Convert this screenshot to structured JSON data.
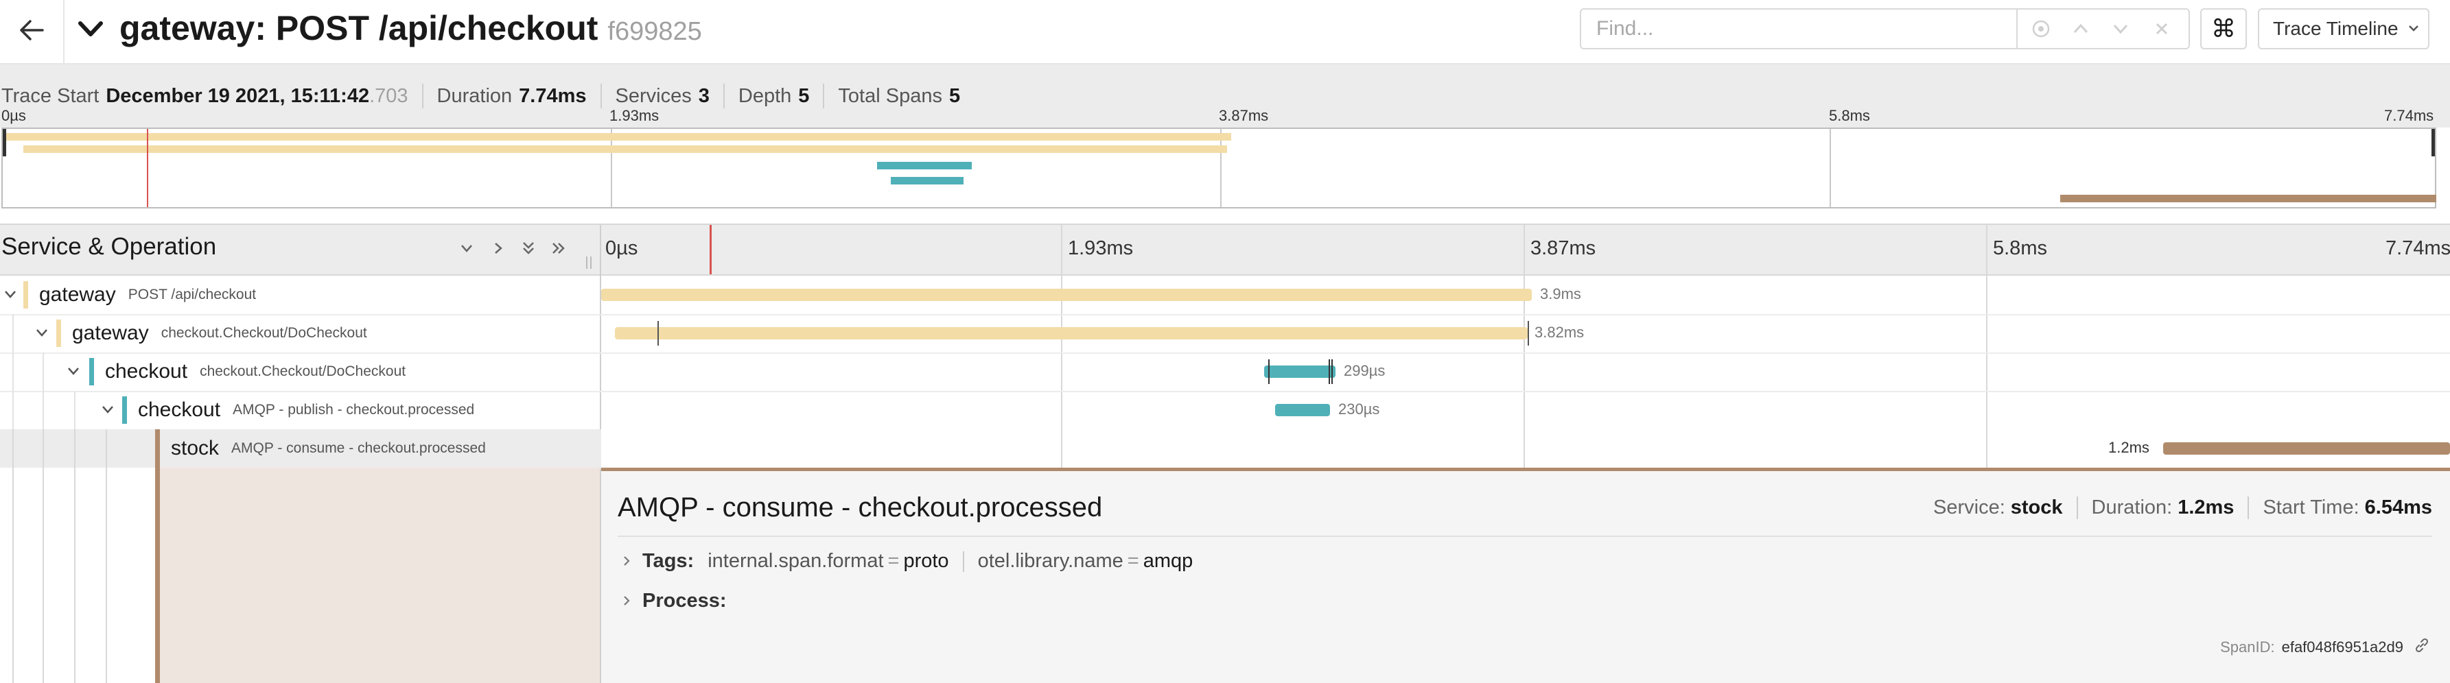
{
  "header": {
    "title": "gateway: POST /api/checkout",
    "trace_id": "f699825",
    "find_placeholder": "Find...",
    "view_select": "Trace Timeline"
  },
  "summary": {
    "trace_start_label": "Trace Start",
    "trace_start_value": "December 19 2021, 15:11:42",
    "trace_start_ms": ".703",
    "duration_label": "Duration",
    "duration_value": "7.74ms",
    "services_label": "Services",
    "services_value": "3",
    "depth_label": "Depth",
    "depth_value": "5",
    "total_spans_label": "Total Spans",
    "total_spans_value": "5"
  },
  "minimap": {
    "ticks": [
      "0µs",
      "1.93ms",
      "3.87ms",
      "5.8ms",
      "7.74ms"
    ]
  },
  "timeline": {
    "column_label": "Service & Operation",
    "ticks": [
      "0µs",
      "1.93ms",
      "3.87ms",
      "5.8ms",
      "7.74ms"
    ]
  },
  "spans": [
    {
      "service": "gateway",
      "operation": "POST /api/checkout",
      "duration": "3.9ms",
      "color": "#f3dca6"
    },
    {
      "service": "gateway",
      "operation": "checkout.Checkout/DoCheckout",
      "duration": "3.82ms",
      "color": "#f3dca6"
    },
    {
      "service": "checkout",
      "operation": "checkout.Checkout/DoCheckout",
      "duration": "299µs",
      "color": "#4fb0b8"
    },
    {
      "service": "checkout",
      "operation": "AMQP - publish - checkout.processed",
      "duration": "230µs",
      "color": "#4fb0b8"
    },
    {
      "service": "stock",
      "operation": "AMQP - consume - checkout.processed",
      "duration": "1.2ms",
      "color": "#b08b6b"
    }
  ],
  "detail": {
    "title": "AMQP - consume - checkout.processed",
    "service_label": "Service:",
    "service_value": "stock",
    "duration_label": "Duration:",
    "duration_value": "1.2ms",
    "start_label": "Start Time:",
    "start_value": "6.54ms",
    "tags_label": "Tags:",
    "tags": [
      {
        "key": "internal.span.format",
        "value": "proto"
      },
      {
        "key": "otel.library.name",
        "value": "amqp"
      }
    ],
    "process_label": "Process:",
    "spanid_label": "SpanID:",
    "spanid_value": "efaf048f6951a2d9"
  },
  "colors": {
    "gateway": "#f3dca6",
    "checkout": "#4fb0b8",
    "stock": "#b08b6b",
    "cursor": "#d9534f"
  }
}
